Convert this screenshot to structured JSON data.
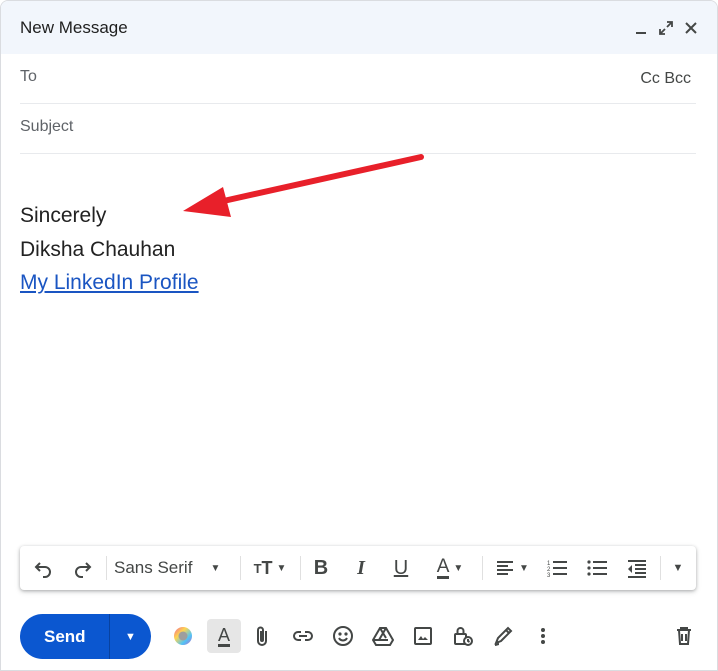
{
  "window": {
    "title": "New Message"
  },
  "fields": {
    "to_label": "To",
    "cc_label": "Cc",
    "bcc_label": "Bcc",
    "subject_placeholder": "Subject"
  },
  "body": {
    "line1": "Sincerely",
    "line2": "Diksha Chauhan",
    "link_text": "My LinkedIn Profile"
  },
  "formatting": {
    "font_name": "Sans Serif"
  },
  "send": {
    "label": "Send"
  },
  "colors": {
    "accent": "#0b57d0",
    "arrow": "#e8202a",
    "link": "#1a55c2"
  },
  "icons": [
    "minimize-icon",
    "expand-icon",
    "close-icon",
    "undo-icon",
    "redo-icon",
    "text-size-icon",
    "bold-icon",
    "italic-icon",
    "underline-icon",
    "text-color-icon",
    "align-icon",
    "numbered-list-icon",
    "bulleted-list-icon",
    "indent-less-icon",
    "more-formatting-icon",
    "send-options-icon",
    "color-picker-icon",
    "formatting-options-icon",
    "attach-icon",
    "link-icon",
    "emoji-icon",
    "drive-icon",
    "photo-icon",
    "confidential-icon",
    "signature-icon",
    "more-options-icon",
    "trash-icon"
  ]
}
